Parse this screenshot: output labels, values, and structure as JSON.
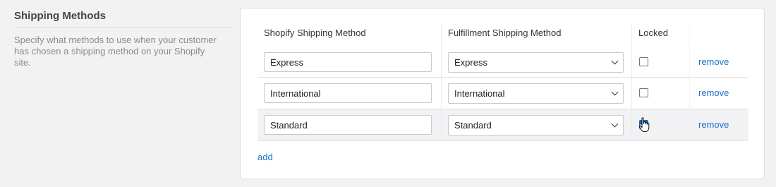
{
  "section": {
    "title": "Shipping Methods",
    "description": "Specify what methods to use when your customer has chosen a shipping method on your Shopify site."
  },
  "table": {
    "headers": {
      "shopify": "Shopify Shipping Method",
      "fulfillment": "Fulfillment Shipping Method",
      "locked": "Locked"
    },
    "rows": [
      {
        "shopify_value": "Express",
        "fulfillment_value": "Express",
        "locked": false,
        "remove_label": "remove"
      },
      {
        "shopify_value": "International",
        "fulfillment_value": "International",
        "locked": false,
        "remove_label": "remove"
      },
      {
        "shopify_value": "Standard",
        "fulfillment_value": "Standard",
        "locked": true,
        "remove_label": "remove"
      }
    ]
  },
  "add_label": "add",
  "colors": {
    "link": "#1a73c8",
    "checkbox_checked": "#1565c0",
    "page_background": "#f2f2f3"
  },
  "icons": {
    "select_arrow": "chevron-down-icon",
    "cursor": "hand-pointer-icon"
  }
}
